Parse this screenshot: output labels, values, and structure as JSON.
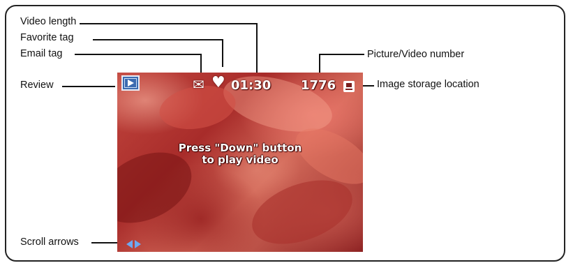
{
  "callouts": {
    "video_length": "Video length",
    "favorite_tag": "Favorite tag",
    "email_tag": "Email tag",
    "review": "Review",
    "picture_video_number": "Picture/Video number",
    "image_storage_location": "Image storage location",
    "scroll_arrows": "Scroll arrows"
  },
  "screen": {
    "video_length": "01:30",
    "picture_number": "1776",
    "message_line1": "Press \"Down\" button",
    "message_line2": "to play video",
    "email_glyph": "✉",
    "favorite_glyph": "♥"
  },
  "icons": [
    "review-icon",
    "email-icon",
    "heart-icon",
    "storage-location-icon",
    "scroll-left-arrow-icon",
    "scroll-right-arrow-icon"
  ],
  "colors": {
    "frame_border": "#222222",
    "review_icon": "#3c6bb0",
    "scroll_arrows": "#6ea8f0",
    "screen_text": "#ffffff"
  }
}
